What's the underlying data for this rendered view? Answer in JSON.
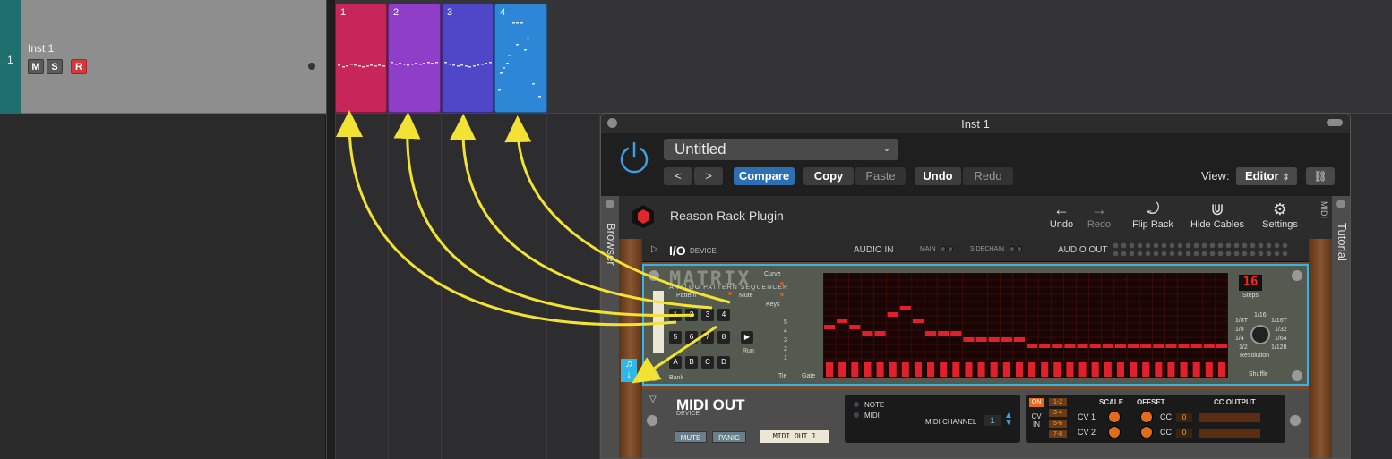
{
  "track": {
    "number": "1",
    "name": "Inst 1",
    "mute_label": "M",
    "solo_label": "S",
    "record_label": "R",
    "color": "#1f6f6f"
  },
  "clips": [
    {
      "label": "1",
      "color": "#c8265a"
    },
    {
      "label": "2",
      "color": "#8e3ec8"
    },
    {
      "label": "3",
      "color": "#5046c8"
    },
    {
      "label": "4",
      "color": "#2e86d6"
    }
  ],
  "plugin": {
    "title": "Inst 1",
    "preset": "Untitled",
    "prev_label": "<",
    "next_label": ">",
    "compare_label": "Compare",
    "copy_label": "Copy",
    "paste_label": "Paste",
    "undo_label": "Undo",
    "redo_label": "Redo",
    "view_label": "View:",
    "view_value": "Editor"
  },
  "rack": {
    "browser_label": "Browser",
    "tutorial_label": "Tutorial",
    "title": "Reason Rack Plugin",
    "tools": {
      "undo": "Undo",
      "redo": "Redo",
      "flip": "Flip Rack",
      "hide_cables": "Hide Cables",
      "settings": "Settings"
    },
    "midi_side": "MIDI",
    "io": {
      "title": "I/O",
      "sub": "DEVICE",
      "audio_in": "AUDIO IN",
      "main": "MAIN",
      "sidechain": "SIDECHAIN",
      "audio_out": "AUDIO OUT"
    },
    "matrix": {
      "logo": "MATRIX",
      "subtitle": "ANALOG PATTERN SEQUENCER",
      "pattern_label": "Pattern",
      "mute_label": "Mute",
      "curve_label": "Curve",
      "keys_label": "Keys",
      "run_label": "Run",
      "bank_label": "Bank",
      "tie_label": "Tie",
      "gate_label": "Gate",
      "steps_value": "16",
      "steps_label": "Steps",
      "resolution_label": "Resolution",
      "shuffle_label": "Shuffle",
      "pads": [
        "1",
        "2",
        "3",
        "4",
        "5",
        "6",
        "7",
        "8"
      ],
      "banks": [
        "A",
        "B",
        "C",
        "D"
      ],
      "octaves": [
        "5",
        "4",
        "3",
        "2",
        "1"
      ],
      "resolutions": [
        "1/16",
        "1/8T",
        "1/16T",
        "1/8",
        "1/32",
        "1/4",
        "1/64",
        "1/2",
        "1/128"
      ],
      "side_label": "MATRIX 1"
    },
    "midi_out": {
      "title": "MIDI OUT",
      "sub": "DEVICE",
      "mute": "MUTE",
      "panic": "PANIC",
      "tag": "MIDI OUT 1",
      "note": "NOTE",
      "midi": "MIDI",
      "channel_label": "MIDI CHANNEL",
      "channel_value": "1",
      "on_label": "ON",
      "cv_in_label": "CV IN",
      "cv_boxes": [
        "1-2",
        "3-4",
        "5-6",
        "7-8"
      ],
      "scale": "SCALE",
      "offset": "OFFSET",
      "cc_output": "CC OUTPUT",
      "cv1": "CV 1",
      "cv2": "CV 2",
      "cc": "CC",
      "cc1_value": "0",
      "cc2_value": "0"
    }
  },
  "colors": {
    "accent_blue": "#2c6fb3",
    "arrow_yellow": "#f2e233",
    "matrix_highlight": "#2fb7e8",
    "power_blue": "#3a9ee0"
  }
}
